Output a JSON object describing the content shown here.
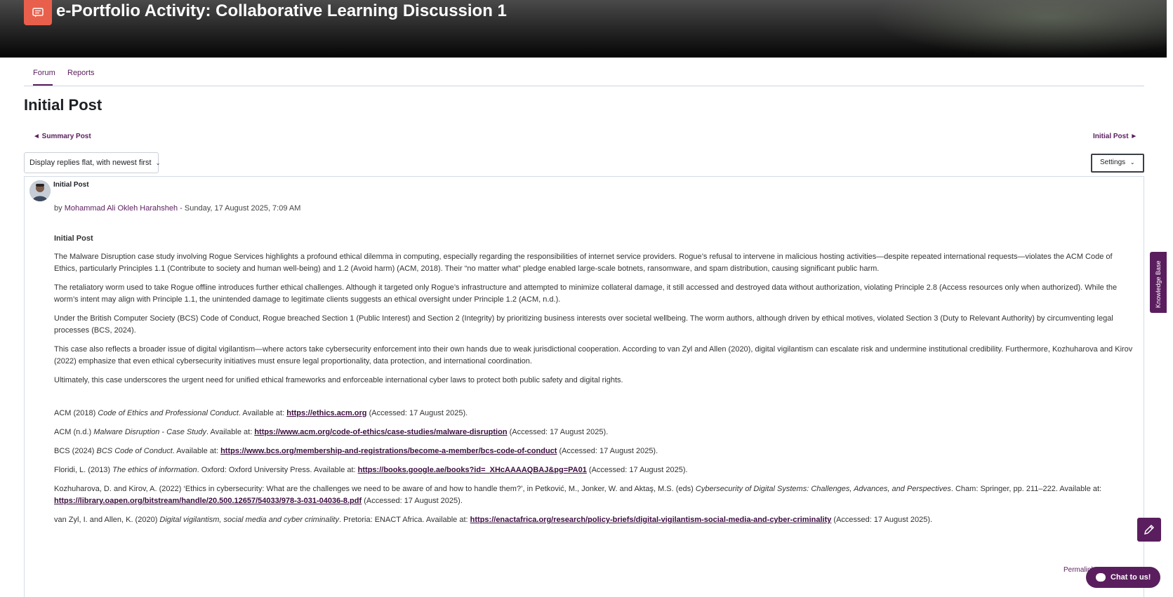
{
  "banner": {
    "title": "e-Portfolio Activity: Collaborative Learning Discussion 1"
  },
  "tabs": [
    {
      "label": "Forum"
    },
    {
      "label": "Reports"
    }
  ],
  "page_title": "Initial Post",
  "nav": {
    "prev": "◄ Summary Post",
    "next": "Initial Post ►"
  },
  "display_select": {
    "value": "Display replies flat, with newest first"
  },
  "settings": {
    "label": "Settings"
  },
  "post": {
    "subject": "Initial Post",
    "by": "by",
    "author": "Mohammad Ali Okleh Harahsheh",
    "date": " - Sunday, 17 August 2025, 7:09 AM",
    "heading": "Initial Post",
    "paragraphs": [
      "The Malware Disruption case study involving Rogue Services highlights a profound ethical dilemma in computing, especially regarding the responsibilities of internet service providers. Rogue’s refusal to intervene in malicious hosting activities—despite repeated international requests—violates the ACM Code of Ethics, particularly Principles 1.1 (Contribute to society and human well-being) and 1.2 (Avoid harm) (ACM, 2018). Their “no matter what” pledge enabled large-scale botnets, ransomware, and spam distribution, causing significant public harm.",
      "The retaliatory worm used to take Rogue offline introduces further ethical challenges. Although it targeted only Rogue’s infrastructure and attempted to minimize collateral damage, it still accessed and destroyed data without authorization, violating Principle 2.8 (Access resources only when authorized). While the worm’s intent may align with Principle 1.1, the unintended damage to legitimate clients suggests an ethical oversight under Principle 1.2 (ACM, n.d.).",
      "Under the British Computer Society (BCS) Code of Conduct, Rogue breached Section 1 (Public Interest) and Section 2 (Integrity) by prioritizing business interests over societal wellbeing. The worm authors, although driven by ethical motives, violated Section 3 (Duty to Relevant Authority) by circumventing legal processes (BCS, 2024).",
      "This case also reflects a broader issue of digital vigilantism—where actors take cybersecurity enforcement into their own hands due to weak jurisdictional cooperation. According to van Zyl and Allen (2020), digital vigilantism can escalate risk and undermine institutional credibility. Furthermore, Kozhuharova and Kirov (2022) emphasize that even ethical cybersecurity initiatives must ensure legal proportionality, data protection, and international coordination.",
      "Ultimately, this case underscores the urgent need for unified ethical frameworks and enforceable international cyber laws to protect both public safety and digital rights."
    ],
    "references": [
      {
        "pre": "ACM (2018) ",
        "title": "Code of Ethics and Professional Conduct",
        "mid": ". Available at: ",
        "url": "https://ethics.acm.org",
        "post": " (Accessed: 17 August 2025)."
      },
      {
        "pre": "ACM (n.d.) ",
        "title": "Malware Disruption - Case Study",
        "mid": ". Available at: ",
        "url": "https://www.acm.org/code-of-ethics/case-studies/malware-disruption",
        "post": " (Accessed: 17 August 2025)."
      },
      {
        "pre": "BCS (2024) ",
        "title": "BCS Code of Conduct",
        "mid": ". Available at: ",
        "url": "https://www.bcs.org/membership-and-registrations/become-a-member/bcs-code-of-conduct",
        "post": " (Accessed: 17 August 2025)."
      },
      {
        "pre": "Floridi, L. (2013) ",
        "title": "The ethics of information",
        "mid": ". Oxford: Oxford University Press. Available at: ",
        "url": "https://books.google.ae/books?id=_XHcAAAAQBAJ&pg=PA01",
        "post": " (Accessed: 17 August 2025)."
      },
      {
        "pre": "Kozhuharova, D. and Kirov, A. (2022) ‘Ethics in cybersecurity: What are the challenges we need to be aware of and how to handle them?’, in Petković, M., Jonker, W. and Aktaş, M.S. (eds) ",
        "title": "Cybersecurity of Digital Systems: Challenges, Advances, and Perspectives",
        "mid": ". Cham: Springer, pp. 211–222. Available at: ",
        "url": "https://library.oapen.org/bitstream/handle/20.500.12657/54033/978-3-031-04036-8.pdf",
        "post": " (Accessed: 17 August 2025)."
      },
      {
        "pre": "van Zyl, I. and Allen, K. (2020) ",
        "title": "Digital vigilantism, social media and cyber criminality",
        "mid": ". Pretoria: ENACT Africa. Available at: ",
        "url": "https://enactafrica.org/research/policy-briefs/digital-vigilantism-social-media-and-cyber-criminality",
        "post": " (Accessed: 17 August 2025)."
      }
    ],
    "permalink": "Permalink"
  },
  "side": {
    "knowledge_base": "Knowledge Base",
    "chat": "Chat to us!"
  },
  "colors": {
    "accent": "#5a1e5e",
    "activity_icon": "#e8604c"
  }
}
